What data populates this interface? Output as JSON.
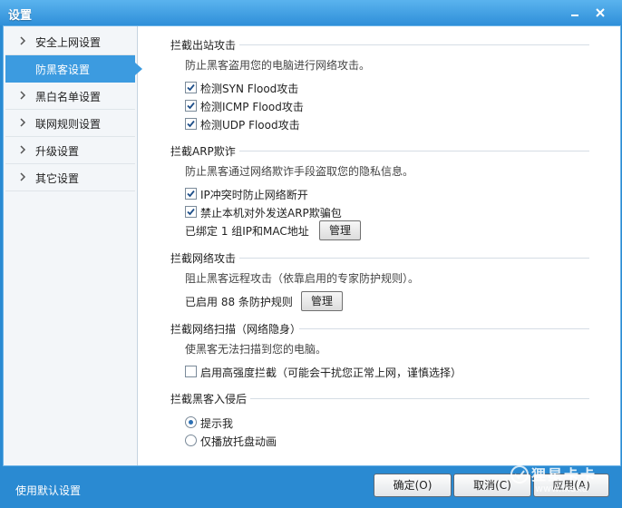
{
  "window": {
    "title": "设置"
  },
  "sidebar": {
    "items": [
      {
        "label": "安全上网设置"
      },
      {
        "label": "防黑客设置"
      },
      {
        "label": "黑白名单设置"
      },
      {
        "label": "联网规则设置"
      },
      {
        "label": "升级设置"
      },
      {
        "label": "其它设置"
      }
    ]
  },
  "sections": {
    "outbound": {
      "title": "拦截出站攻击",
      "desc": "防止黑客盗用您的电脑进行网络攻击。",
      "checks": [
        {
          "label": "检测SYN Flood攻击",
          "checked": true
        },
        {
          "label": "检测ICMP Flood攻击",
          "checked": true
        },
        {
          "label": "检测UDP Flood攻击",
          "checked": true
        }
      ]
    },
    "arp": {
      "title": "拦截ARP欺诈",
      "desc": "防止黑客通过网络欺诈手段盗取您的隐私信息。",
      "checks": [
        {
          "label": "IP冲突时防止网络断开",
          "checked": true
        },
        {
          "label": "禁止本机对外发送ARP欺骗包",
          "checked": true
        }
      ],
      "bound_text": "已绑定 1 组IP和MAC地址",
      "manage_label": "管理"
    },
    "network": {
      "title": "拦截网络攻击",
      "desc": "阻止黑客远程攻击（依靠启用的专家防护规则）。",
      "rules_text": "已启用 88 条防护规则",
      "manage_label": "管理"
    },
    "scan": {
      "title": "拦截网络扫描（网络隐身）",
      "desc": "使黑客无法扫描到您的电脑。",
      "checks": [
        {
          "label": "启用高强度拦截（可能会干扰您正常上网，谨慎选择）",
          "checked": false
        }
      ]
    },
    "intrusion": {
      "title": "拦截黑客入侵后",
      "radios": [
        {
          "label": "提示我",
          "selected": true
        },
        {
          "label": "仅播放托盘动画",
          "selected": false
        }
      ]
    }
  },
  "footer": {
    "default_link": "使用默认设置",
    "ok_label": "确定(O)",
    "cancel_label": "取消(C)",
    "apply_label": "应用(A)"
  },
  "watermark": {
    "line1": "狸星卡卡",
    "line2": "www.ikaka"
  }
}
